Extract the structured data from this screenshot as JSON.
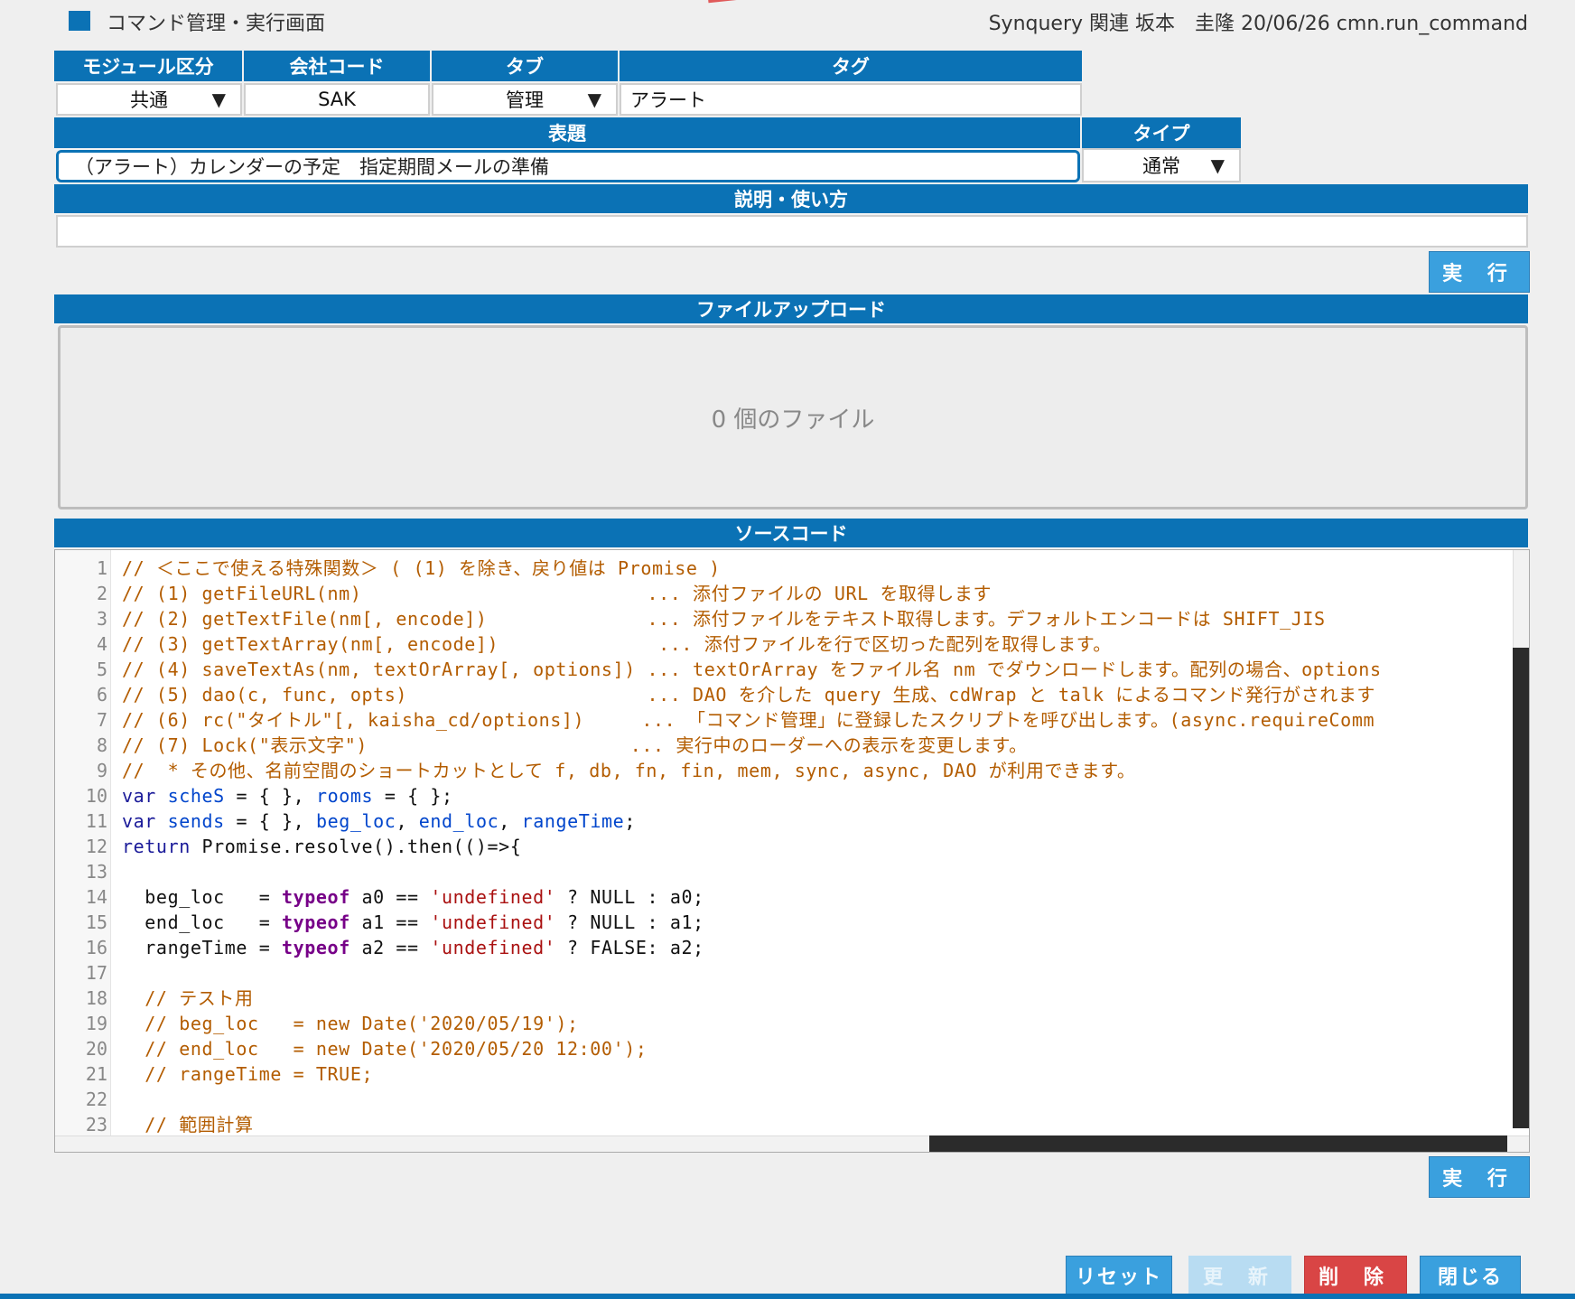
{
  "header": {
    "title": "コマンド管理・実行画面",
    "meta": "Synquery 関連 坂本　圭隆 20/06/26 cmn.run_command"
  },
  "fields": {
    "module_label": "モジュール区分",
    "module_value": "共通",
    "company_label": "会社コード",
    "company_value": "SAK",
    "tab_label": "タブ",
    "tab_value": "管理",
    "tag_label": "タグ",
    "tag_value": "アラート",
    "title_label": "表題",
    "title_value": "（アラート）カレンダーの予定　指定期間メールの準備",
    "type_label": "タイプ",
    "type_value": "通常",
    "desc_label": "説明・使い方",
    "desc_value": ""
  },
  "buttons": {
    "run": "実 行",
    "reset": "リセット",
    "update": "更 新",
    "delete": "削 除",
    "close": "閉じる"
  },
  "upload": {
    "label": "ファイルアップロード",
    "count_text": "0 個のファイル"
  },
  "source": {
    "label": "ソースコード",
    "line_numbers": [
      "1",
      "2",
      "3",
      "4",
      "5",
      "6",
      "7",
      "8",
      "9",
      "10",
      "11",
      "12",
      "13",
      "14",
      "15",
      "16",
      "17",
      "18",
      "19",
      "20",
      "21",
      "22",
      "23"
    ],
    "lines": [
      "// ＜ここで使える特殊関数＞ ( (1) を除き、戻り値は Promise )",
      "// (1) getFileURL(nm)                         ... 添付ファイルの URL を取得します",
      "// (2) getTextFile(nm[, encode])              ... 添付ファイルをテキスト取得します。デフォルトエンコードは SHIFT_JIS",
      "// (3) getTextArray(nm[, encode])              ... 添付ファイルを行で区切った配列を取得します。",
      "// (4) saveTextAs(nm, textOrArray[, options]) ... textOrArray をファイル名 nm でダウンロードします。配列の場合、options",
      "// (5) dao(c, func, opts)                     ... DAO を介した query 生成、cdWrap と talk によるコマンド発行がされます",
      "// (6) rc(\"タイトル\"[, kaisha_cd/options])     ... 「コマンド管理」に登録したスクリプトを呼び出します。(async.requireComm",
      "// (7) Lock(\"表示文字\")                       ... 実行中のローダーへの表示を変更します。",
      "//  * その他、名前空間のショートカットとして f, db, fn, fin, mem, sync, async, DAO が利用できます。",
      "var scheS = { }, rooms = { };",
      "var sends = { }, beg_loc, end_loc, rangeTime;",
      "return Promise.resolve().then(()=>{",
      "",
      "  beg_loc   = typeof a0 == 'undefined' ? NULL : a0;",
      "  end_loc   = typeof a1 == 'undefined' ? NULL : a1;",
      "  rangeTime = typeof a2 == 'undefined' ? FALSE: a2;",
      "",
      "  // テスト用",
      "  // beg_loc   = new Date('2020/05/19');",
      "  // end_loc   = new Date('2020/05/20 12:00');",
      "  // rangeTime = TRUE;",
      "",
      "  // 範囲計算"
    ]
  },
  "colors": {
    "accent": "#0b72b5",
    "button_blue": "#3aa0de",
    "button_red": "#d94545",
    "comment": "#b35c00"
  }
}
